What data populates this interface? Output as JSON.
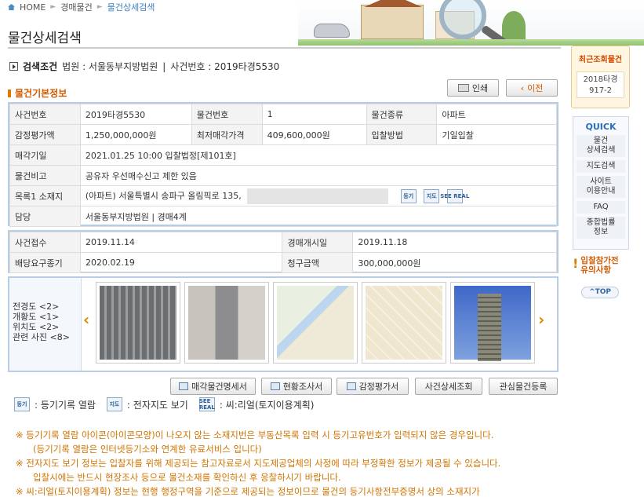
{
  "breadcrumb": {
    "home": "HOME",
    "level1": "경매물건",
    "current": "물건상세검색"
  },
  "page_title": "물건상세검색",
  "search": {
    "label": "검색조건",
    "court": "법원 : 서울동부지방법원",
    "divider": "|",
    "case": "사건번호 : 2019타경5530"
  },
  "buttons": {
    "print": "인쇄",
    "back": "이전"
  },
  "section_title": "물건기본정보",
  "basic": {
    "case_no_k": "사건번호",
    "case_no_v": "2019타경5530",
    "item_no_k": "물건번호",
    "item_no_v": "1",
    "type_k": "물건종류",
    "type_v": "아파트",
    "appraisal_k": "감정평가액",
    "appraisal_v": "1,250,000,000원",
    "min_price_k": "최저매각가격",
    "min_price_v": "409,600,000원",
    "bid_method_k": "입찰방법",
    "bid_method_v": "기일입찰",
    "sale_date_k": "매각기일",
    "sale_date_v": "2021.01.25 10:00 입찰법정[제101호]",
    "remarks_k": "물건비고",
    "remarks_v": "공유자 우선매수신고 제한 있음",
    "address_k": "목록1 소재지",
    "address_v": "(아파트) 서울특별시 송파구 올림픽로 135,",
    "manager_k": "담당",
    "manager_v": "서울동부지방법원 | 경매4계"
  },
  "dates": {
    "received_k": "사건접수",
    "received_v": "2019.11.14",
    "start_k": "경매개시일",
    "start_v": "2019.11.18",
    "dividend_k": "배당요구종기",
    "dividend_v": "2020.02.19",
    "claim_k": "청구금액",
    "claim_v": "300,000,000원"
  },
  "photos": {
    "labels": [
      "전경도 <2>",
      "개황도 <1>",
      "위치도 <2>",
      "관련 사진 <8>"
    ]
  },
  "action_buttons": {
    "sale_statement": "매각물건명세서",
    "survey": "현황조사서",
    "appraisal": "감정평가서",
    "case_detail": "사건상세조회",
    "watch": "관심물건등록"
  },
  "icons": {
    "registry": "등기",
    "map": "지도",
    "seereal": "SEE REAL"
  },
  "legend": {
    "registry": ": 등기기록 열람",
    "map": ": 전자지도 보기",
    "seereal": ": 씨:리얼(토지이용계획)"
  },
  "notes": [
    "※ 등기기록 열람 아이콘(아이콘모양)이 나오지 않는 소재지번은 부동산목록 입력 시 등기고유번호가 입력되지 않은 경우입니다.",
    "(등기기록 열람은 인터넷등기소와 연계한 유료서비스 입니다)",
    "※ 전자지도 보기 정보는 입찰자를 위해 제공되는 참고자료로서 지도제공업체의 사정에 따라 부정확한 정보가 제공될 수 있습니다.",
    "입찰시에는 반드시 현장조사 등으로 물건소재를 확인하신 후 응찰하시기 바랍니다.",
    "※ 씨:리얼(토지이용계획) 정보는 현행 행정구역을 기준으로 제공되는 정보이므로 물건의 등기사항전부증명서 상의 소재지가"
  ],
  "sidebar": {
    "recent_title": "최근조회물건",
    "recent_item_line1": "2018타경",
    "recent_item_line2": "917-2",
    "quick_title": "QUICK",
    "quick_items": [
      [
        "물건",
        "상세검색"
      ],
      [
        "지도검색"
      ],
      [
        "사이트",
        "이용안내"
      ],
      [
        "FAQ"
      ],
      [
        "종합법률",
        "정보"
      ]
    ],
    "warn_line1": "입찰참가전",
    "warn_line2": "유의사항",
    "top": "TOP"
  },
  "colors": {
    "accent": "#d35a00",
    "link": "#3b7fc0",
    "frame": "#b7cde3"
  }
}
